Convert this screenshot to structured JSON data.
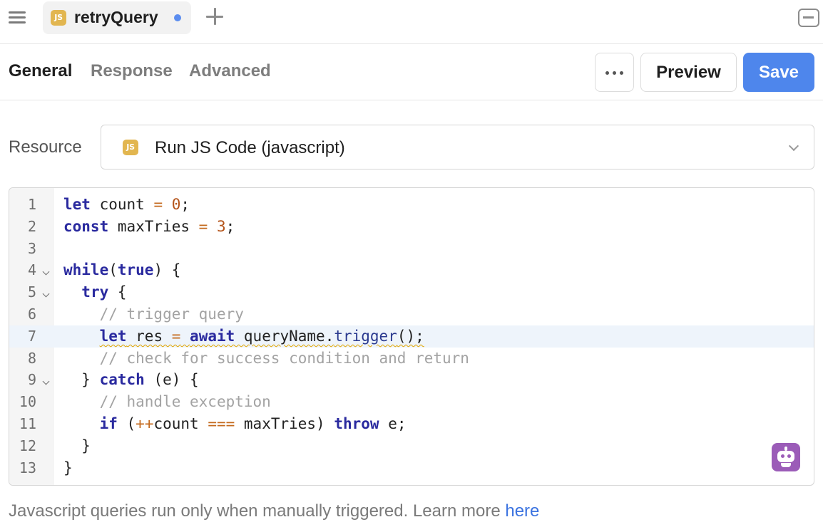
{
  "tab": {
    "title": "retryQuery",
    "badge": "JS",
    "unsaved": true
  },
  "subtabs": [
    {
      "label": "General",
      "active": true
    },
    {
      "label": "Response",
      "active": false
    },
    {
      "label": "Advanced",
      "active": false
    }
  ],
  "toolbar": {
    "more_icon": "more-horizontal-icon",
    "preview_label": "Preview",
    "save_label": "Save"
  },
  "resource": {
    "label": "Resource",
    "badge": "JS",
    "value": "Run JS Code (javascript)"
  },
  "editor": {
    "active_line": 7,
    "lines": [
      {
        "n": "1",
        "code": "let count = 0;"
      },
      {
        "n": "2",
        "code": "const maxTries = 3;"
      },
      {
        "n": "3",
        "code": ""
      },
      {
        "n": "4",
        "code": "while(true) {",
        "fold": true
      },
      {
        "n": "5",
        "code": "  try {",
        "fold": true
      },
      {
        "n": "6",
        "code": "    // trigger query"
      },
      {
        "n": "7",
        "code": "    let res = await queryName.trigger();"
      },
      {
        "n": "8",
        "code": "    // check for success condition and return"
      },
      {
        "n": "9",
        "code": "  } catch (e) {",
        "fold": true
      },
      {
        "n": "10",
        "code": "    // handle exception"
      },
      {
        "n": "11",
        "code": "    if (++count === maxTries) throw e;"
      },
      {
        "n": "12",
        "code": "  }"
      },
      {
        "n": "13",
        "code": "}"
      }
    ]
  },
  "footer": {
    "text": "Javascript queries run only when manually triggered. Learn more ",
    "link": "here"
  },
  "colors": {
    "accent": "#4e86ec",
    "js_badge": "#e2b650",
    "unsaved_dot": "#5b8def",
    "ai_button": "#9b5cb8"
  }
}
